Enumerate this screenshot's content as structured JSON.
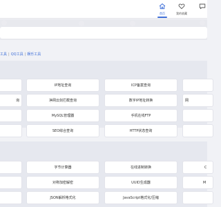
{
  "nav": {
    "home_label": "首页",
    "favorites_label": "我的收藏"
  },
  "breadcrumb": {
    "items": [
      "工具",
      "QQ工具",
      "娱乐工具"
    ],
    "separator": "|"
  },
  "section1": {
    "rows": [
      [
        "",
        "IP地址查询",
        "ICP备案查询",
        ""
      ],
      [
        "询",
        "净网云剑拦截查询",
        "数字IP地址转换",
        "网"
      ],
      [
        "",
        "MySQL管理器",
        "手机在线FTP",
        ""
      ],
      [
        "",
        "SEO综合查询",
        "HTTP状态查询",
        ""
      ]
    ]
  },
  "section2": {
    "rows": [
      [
        "",
        "字节计算器",
        "在线进制转换",
        "C"
      ],
      [
        "",
        "对称加密解密",
        "UUID生成器",
        "M"
      ],
      [
        "",
        "JSON解析格式化",
        "JavaScript格式化/压缩",
        ""
      ]
    ]
  },
  "colors": {
    "accent": "#3f6fd8",
    "page_bg": "#f1f2f6",
    "section_bg": "#e6e8ef",
    "card_bg": "#ffffff"
  }
}
